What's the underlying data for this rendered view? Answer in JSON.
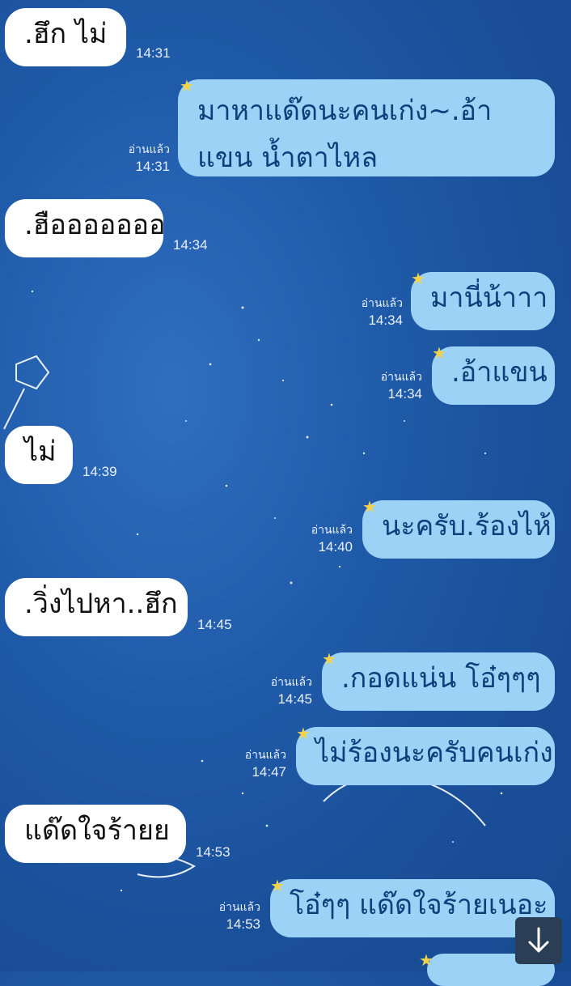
{
  "messages": [
    {
      "text": ".ฮึก  ไม่",
      "time": "14:31"
    },
    {
      "text": "มาหาแด๊ดนะคนเก่ง~.อ้าแขน น้ำตาไหล",
      "read": "อ่านแล้ว",
      "time": "14:31"
    },
    {
      "text": ".ฮือออออออ",
      "time": "14:34"
    },
    {
      "text": "มานี่น้าาา",
      "read": "อ่านแล้ว",
      "time": "14:34"
    },
    {
      "text": ".อ้าแขน",
      "read": "อ่านแล้ว",
      "time": "14:34"
    },
    {
      "text": "ไม่",
      "time": "14:39"
    },
    {
      "text": "นะครับ.ร้องไห้",
      "read": "อ่านแล้ว",
      "time": "14:40"
    },
    {
      "text": ".วิ่งไปหา..ฮึก",
      "time": "14:45"
    },
    {
      "text": ".กอดแน่น โอ๋ๆๆๆ",
      "read": "อ่านแล้ว",
      "time": "14:45"
    },
    {
      "text": "ไม่ร้องนะครับคนเก่ง",
      "read": "อ่านแล้ว",
      "time": "14:47"
    },
    {
      "text": "แด๊ดใจร้ายย",
      "time": "14:53"
    },
    {
      "text": "โอ๋ๆๆ แด๊ดใจร้ายเนอะ",
      "read": "อ่านแล้ว",
      "time": "14:53"
    }
  ],
  "colors": {
    "incoming": "#ffffff",
    "outgoing": "#9dd2f7",
    "background": "#1f5aa8"
  },
  "scroll_button": {
    "icon": "arrow-down-icon"
  }
}
